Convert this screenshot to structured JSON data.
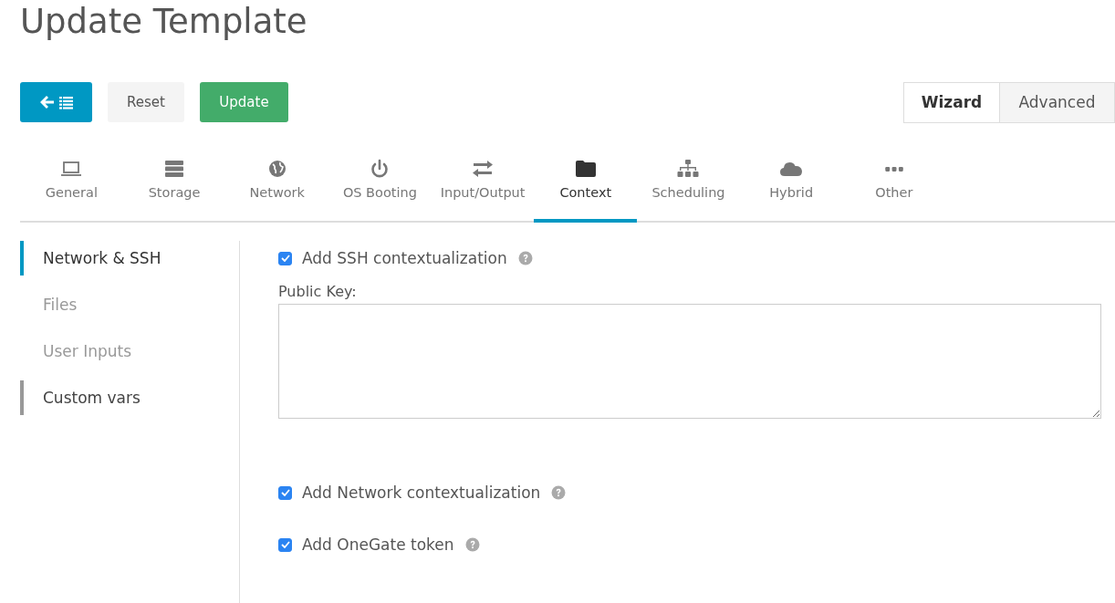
{
  "page_title": "Update Template",
  "toolbar": {
    "reset": "Reset",
    "update": "Update"
  },
  "mode_tabs": [
    {
      "label": "Wizard",
      "selected": true
    },
    {
      "label": "Advanced",
      "selected": false
    }
  ],
  "tabs": [
    {
      "label": "General",
      "selected": false
    },
    {
      "label": "Storage",
      "selected": false
    },
    {
      "label": "Network",
      "selected": false
    },
    {
      "label": "OS Booting",
      "selected": false
    },
    {
      "label": "Input/Output",
      "selected": false
    },
    {
      "label": "Context",
      "selected": true
    },
    {
      "label": "Scheduling",
      "selected": false
    },
    {
      "label": "Hybrid",
      "selected": false
    },
    {
      "label": "Other",
      "selected": false
    }
  ],
  "side_nav": [
    {
      "label": "Network & SSH",
      "selected": true,
      "hovered": false
    },
    {
      "label": "Files",
      "selected": false,
      "hovered": false
    },
    {
      "label": "User Inputs",
      "selected": false,
      "hovered": false
    },
    {
      "label": "Custom vars",
      "selected": false,
      "hovered": true
    }
  ],
  "ssh": {
    "label": "Add SSH contextualization",
    "checked": true
  },
  "public_key": {
    "label": "Public Key:"
  },
  "options": [
    {
      "label": "Add Network contextualization",
      "checked": true
    },
    {
      "label": "Add OneGate token",
      "checked": true
    }
  ]
}
